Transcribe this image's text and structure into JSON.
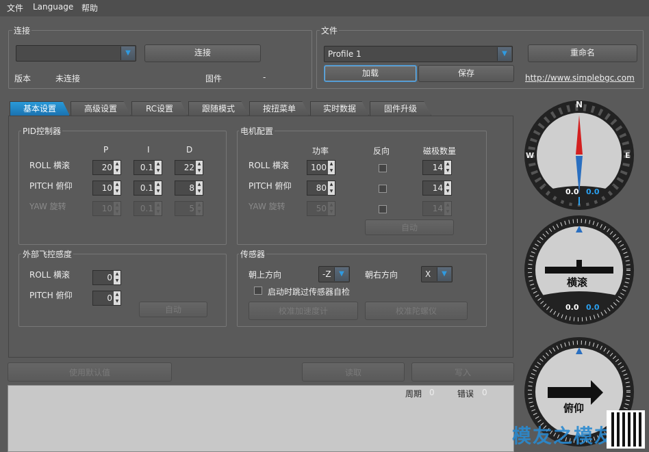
{
  "menu": [
    "文件",
    "Language",
    "帮助"
  ],
  "connection": {
    "title": "连接",
    "port_value": "",
    "connect_label": "连接",
    "version_label": "版本",
    "version_value": "未连接",
    "firmware_label": "固件",
    "firmware_value": "-"
  },
  "file": {
    "title": "文件",
    "profile_value": "Profile 1",
    "rename_label": "重命名",
    "load_label": "加载",
    "save_label": "保存",
    "link": "http://www.simplebgc.com"
  },
  "tabs": [
    "基本设置",
    "高级设置",
    "RC设置",
    "跟随模式",
    "按扭菜单",
    "实时数据",
    "固件升级"
  ],
  "pid": {
    "title": "PID控制器",
    "headers": [
      "P",
      "I",
      "D"
    ],
    "rows": [
      {
        "label": "ROLL 横滚",
        "p": "20",
        "i": "0.1",
        "d": "22"
      },
      {
        "label": "PITCH 俯仰",
        "p": "10",
        "i": "0.1",
        "d": "8"
      },
      {
        "label": "YAW 旋转",
        "p": "10",
        "i": "0.1",
        "d": "5"
      }
    ]
  },
  "motor": {
    "title": "电机配置",
    "headers": [
      "功率",
      "反向",
      "磁极数量"
    ],
    "rows": [
      {
        "label": "ROLL 横滚",
        "power": "100",
        "poles": "14"
      },
      {
        "label": "PITCH 俯仰",
        "power": "80",
        "poles": "14"
      },
      {
        "label": "YAW 旋转",
        "power": "50",
        "poles": "14"
      }
    ],
    "auto_label": "自动"
  },
  "ext": {
    "title": "外部飞控感度",
    "rows": [
      {
        "label": "ROLL 横滚",
        "value": "0"
      },
      {
        "label": "PITCH 俯仰",
        "value": "0"
      }
    ],
    "auto_label": "自动"
  },
  "sensor": {
    "title": "传感器",
    "up_label": "朝上方向",
    "up_value": "-Z",
    "right_label": "朝右方向",
    "right_value": "X",
    "skip_label": "启动时跳过传感器自检",
    "calib_acc_label": "校准加速度计",
    "calib_gyro_label": "校准陀螺仪"
  },
  "bottom": {
    "defaults_label": "使用默认值",
    "read_label": "读取",
    "write_label": "写入",
    "cycle_label": "周期",
    "cycle_value": "0",
    "error_label": "错误",
    "error_value": "0"
  },
  "gauges": {
    "compass": {
      "n": "N",
      "w": "W",
      "e": "E",
      "v1": "0.0",
      "v2": "0.0"
    },
    "roll": {
      "label": "横滚",
      "v1": "0.0",
      "v2": "0.0"
    },
    "pitch": {
      "label": "俯仰"
    }
  },
  "watermark": "模友之模友"
}
